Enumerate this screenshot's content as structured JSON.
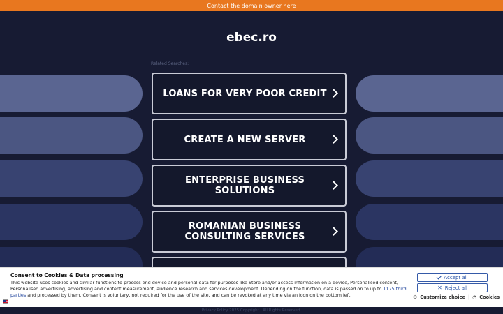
{
  "topbar": {
    "text": "Contact the domain owner here"
  },
  "header": {
    "domain": "ebec.ro"
  },
  "related": {
    "label": "Related Searches:"
  },
  "links": [
    {
      "label": "LOANS FOR VERY POOR CREDIT"
    },
    {
      "label": "CREATE A NEW SERVER"
    },
    {
      "label": "ENTERPRISE BUSINESS SOLUTIONS"
    },
    {
      "label": "ROMANIAN BUSINESS CONSULTING SERVICES"
    },
    {
      "label": ""
    }
  ],
  "footer": {
    "text": "Privacy Policy   2025 Copyright | All Rights Reserved."
  },
  "consent": {
    "title": "Consent to Cookies & Data processing",
    "text_before": "This website uses cookies and similar functions to process end device and personal data for purposes like Store and/or access information on a device, Personalised content, Personalised advertising, advertising and content measurement, audience research and services development. Depending on the function, data is passed on to up to ",
    "third_parties_link": "1175 third parties",
    "text_after": " and processed by them. Consent is voluntary, not required for the use of the site, and can be revoked at any time via an icon on the bottom left.",
    "accept_label": "Accept all",
    "reject_label": "Reject all",
    "customize_label": "Customize choice",
    "separator": "|",
    "cookies_label": "Cookies"
  }
}
